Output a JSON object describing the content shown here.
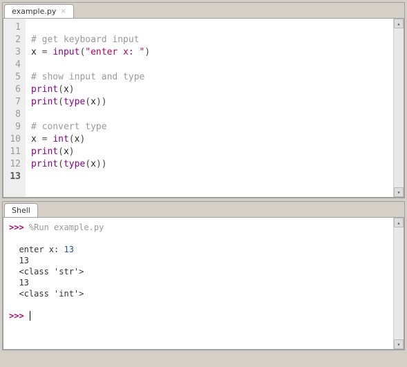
{
  "editor": {
    "tab_label": "example.py",
    "lines": [
      {
        "n": 1,
        "tokens": []
      },
      {
        "n": 2,
        "tokens": [
          {
            "t": "# get keyboard input",
            "c": "c-comment"
          }
        ]
      },
      {
        "n": 3,
        "tokens": [
          {
            "t": "x ",
            "c": "c-ident"
          },
          {
            "t": "= ",
            "c": "c-op"
          },
          {
            "t": "input",
            "c": "c-builtin"
          },
          {
            "t": "(",
            "c": "c-paren"
          },
          {
            "t": "\"enter x: \"",
            "c": "c-string"
          },
          {
            "t": ")",
            "c": "c-paren"
          }
        ]
      },
      {
        "n": 4,
        "tokens": []
      },
      {
        "n": 5,
        "tokens": [
          {
            "t": "# show input and type",
            "c": "c-comment"
          }
        ]
      },
      {
        "n": 6,
        "tokens": [
          {
            "t": "print",
            "c": "c-builtin"
          },
          {
            "t": "(",
            "c": "c-paren"
          },
          {
            "t": "x",
            "c": "c-ident"
          },
          {
            "t": ")",
            "c": "c-paren"
          }
        ]
      },
      {
        "n": 7,
        "tokens": [
          {
            "t": "print",
            "c": "c-builtin"
          },
          {
            "t": "(",
            "c": "c-paren"
          },
          {
            "t": "type",
            "c": "c-builtin"
          },
          {
            "t": "(",
            "c": "c-paren"
          },
          {
            "t": "x",
            "c": "c-ident"
          },
          {
            "t": ")",
            "c": "c-paren"
          },
          {
            "t": ")",
            "c": "c-paren"
          }
        ]
      },
      {
        "n": 8,
        "tokens": []
      },
      {
        "n": 9,
        "tokens": [
          {
            "t": "# convert type",
            "c": "c-comment"
          }
        ]
      },
      {
        "n": 10,
        "tokens": [
          {
            "t": "x ",
            "c": "c-ident"
          },
          {
            "t": "= ",
            "c": "c-op"
          },
          {
            "t": "int",
            "c": "c-builtin"
          },
          {
            "t": "(",
            "c": "c-paren"
          },
          {
            "t": "x",
            "c": "c-ident"
          },
          {
            "t": ")",
            "c": "c-paren"
          }
        ]
      },
      {
        "n": 11,
        "tokens": [
          {
            "t": "print",
            "c": "c-builtin"
          },
          {
            "t": "(",
            "c": "c-paren"
          },
          {
            "t": "x",
            "c": "c-ident"
          },
          {
            "t": ")",
            "c": "c-paren"
          }
        ]
      },
      {
        "n": 12,
        "tokens": [
          {
            "t": "print",
            "c": "c-builtin"
          },
          {
            "t": "(",
            "c": "c-paren"
          },
          {
            "t": "type",
            "c": "c-builtin"
          },
          {
            "t": "(",
            "c": "c-paren"
          },
          {
            "t": "x",
            "c": "c-ident"
          },
          {
            "t": ")",
            "c": "c-paren"
          },
          {
            "t": ")",
            "c": "c-paren"
          }
        ]
      },
      {
        "n": 13,
        "tokens": [],
        "current": true
      }
    ]
  },
  "shell": {
    "tab_label": "Shell",
    "prompt": ">>>",
    "run_cmd": "%Run example.py",
    "output": {
      "prompt_text": "enter x: ",
      "input_value": "13",
      "lines": [
        "13",
        "<class 'str'>",
        "13",
        "<class 'int'>"
      ]
    }
  },
  "scroll": {
    "up": "▴",
    "down": "▾"
  }
}
